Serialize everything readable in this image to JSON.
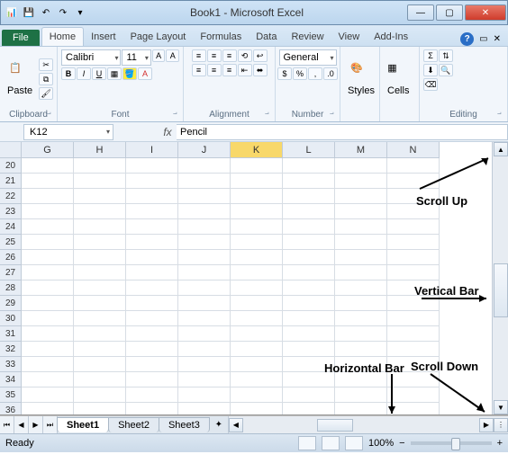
{
  "title": "Book1 - Microsoft Excel",
  "qat": {
    "save": "💾",
    "undo": "↶",
    "redo": "↷"
  },
  "win": {
    "min": "—",
    "max": "▢",
    "close": "✕"
  },
  "tabs": {
    "file": "File",
    "items": [
      "Home",
      "Insert",
      "Page Layout",
      "Formulas",
      "Data",
      "Review",
      "View",
      "Add-Ins"
    ],
    "active": "Home"
  },
  "ribbon": {
    "clipboard": {
      "paste": "Paste",
      "label": "Clipboard"
    },
    "font": {
      "name": "Calibri",
      "size": "11",
      "label": "Font"
    },
    "alignment": {
      "label": "Alignment"
    },
    "number": {
      "format": "General",
      "label": "Number"
    },
    "styles": {
      "btn": "Styles"
    },
    "cells": {
      "btn": "Cells"
    },
    "editing": {
      "label": "Editing"
    }
  },
  "namebox": "K12",
  "fx": "fx",
  "formula": "Pencil",
  "columns": [
    "G",
    "H",
    "I",
    "J",
    "K",
    "L",
    "M",
    "N"
  ],
  "selectedCol": "K",
  "rows": [
    "20",
    "21",
    "22",
    "23",
    "24",
    "25",
    "26",
    "27",
    "28",
    "29",
    "30",
    "31",
    "32",
    "33",
    "34",
    "35",
    "36"
  ],
  "sheetnav": [
    "⏮",
    "◀",
    "▶",
    "⏭"
  ],
  "sheets": [
    "Sheet1",
    "Sheet2",
    "Sheet3"
  ],
  "activeSheet": "Sheet1",
  "newsheet": "✦",
  "status": "Ready",
  "zoom": "100%",
  "anno": {
    "scrollUp": "Scroll Up",
    "verticalBar": "Vertical Bar",
    "horizontalBar": "Horizontal Bar",
    "scrollDown": "Scroll Down"
  }
}
